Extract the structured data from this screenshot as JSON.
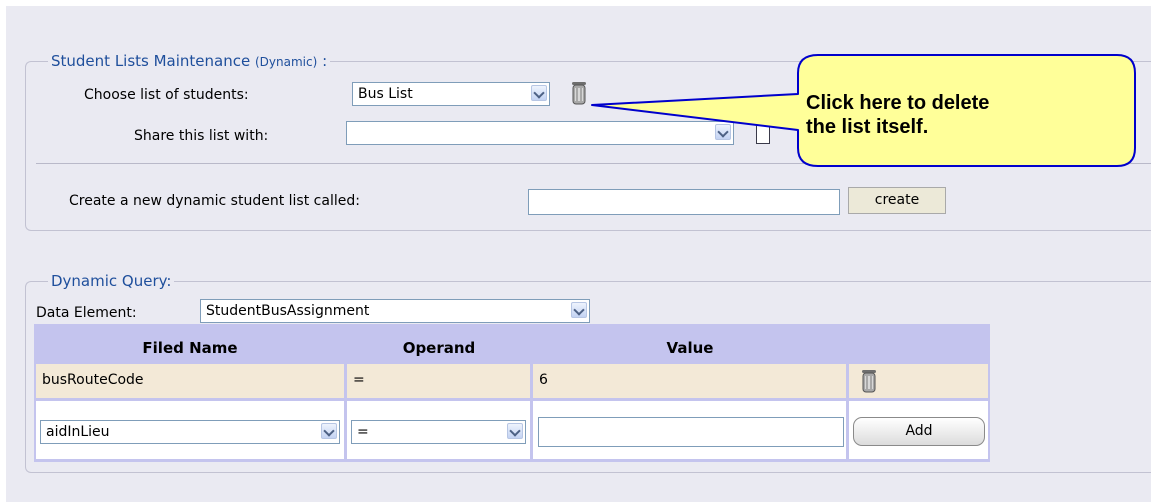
{
  "list_maintenance": {
    "legend": "Student Lists Maintenance",
    "legend_tag": "(Dynamic)",
    "legend_colon": ":",
    "choose_label": "Choose list of students:",
    "choose_value": "Bus List",
    "share_label": "Share this list with:",
    "share_value": "",
    "create_label": "Create a new dynamic student list called:",
    "create_input_value": "",
    "create_button": "create"
  },
  "callout": {
    "line1": "Click here to delete",
    "line2": "the list itself."
  },
  "dynamic_query": {
    "legend": "Dynamic Query:",
    "data_element_label": "Data Element:",
    "data_element_value": "StudentBusAssignment",
    "columns": [
      "Filed Name",
      "Operand",
      "Value"
    ],
    "row": {
      "field": "busRouteCode",
      "operand": "=",
      "value": "6"
    },
    "new_row": {
      "field": "aidInLieu",
      "operand": "=",
      "value": "",
      "add_button": "Add"
    }
  },
  "colors": {
    "page_bg": "#eaeaf2",
    "legend_text": "#1f4f9c",
    "table_header": "#c4c4ee",
    "table_row": "#f3e9d7",
    "callout_fill": "#ffff99",
    "callout_border": "#0000cc"
  },
  "icons": {
    "delete": "trash-can-icon",
    "dropdown": "chevron-down-icon"
  }
}
